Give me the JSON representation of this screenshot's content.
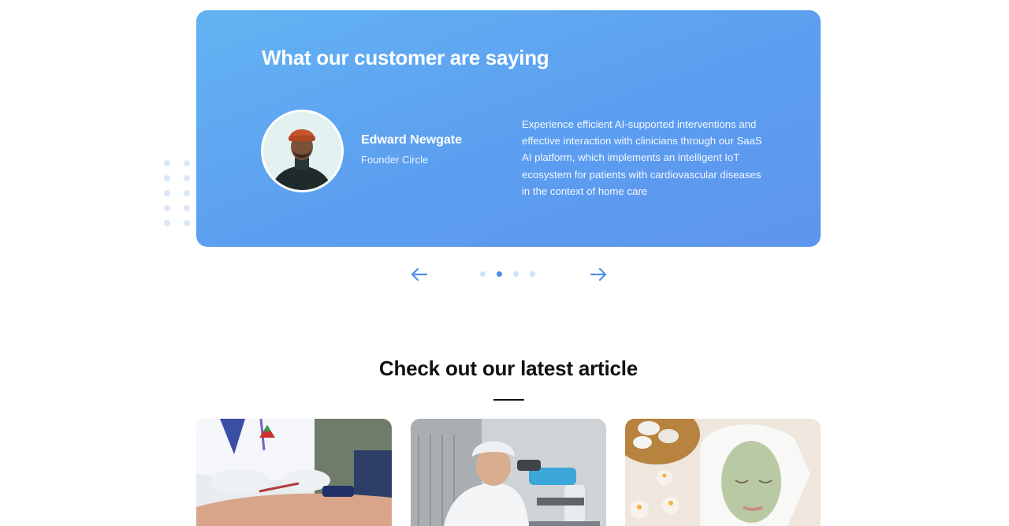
{
  "testimonial": {
    "title": "What our customer are saying",
    "name": "Edward Newgate",
    "role": "Founder Circle",
    "quote": "Experience efficient AI-supported interventions and effective interaction with clinicians through our SaaS AI platform, which implements an intelligent IoT ecosystem for patients with cardiovascular diseases in the context of home care"
  },
  "carousel": {
    "slide_count": 4,
    "active_index": 1,
    "prev_icon": "arrow-left-icon",
    "next_icon": "arrow-right-icon"
  },
  "articles": {
    "title": "Check out our latest article",
    "items": [
      {
        "image": "blood-draw-photo"
      },
      {
        "image": "lab-microscope-photo"
      },
      {
        "image": "spa-face-mask-photo"
      }
    ]
  },
  "colors": {
    "card_gradient_start": "#63b3f2",
    "card_gradient_end": "#5e95ee",
    "accent": "#4f8fe6",
    "dot_inactive": "#cfe2f7"
  }
}
